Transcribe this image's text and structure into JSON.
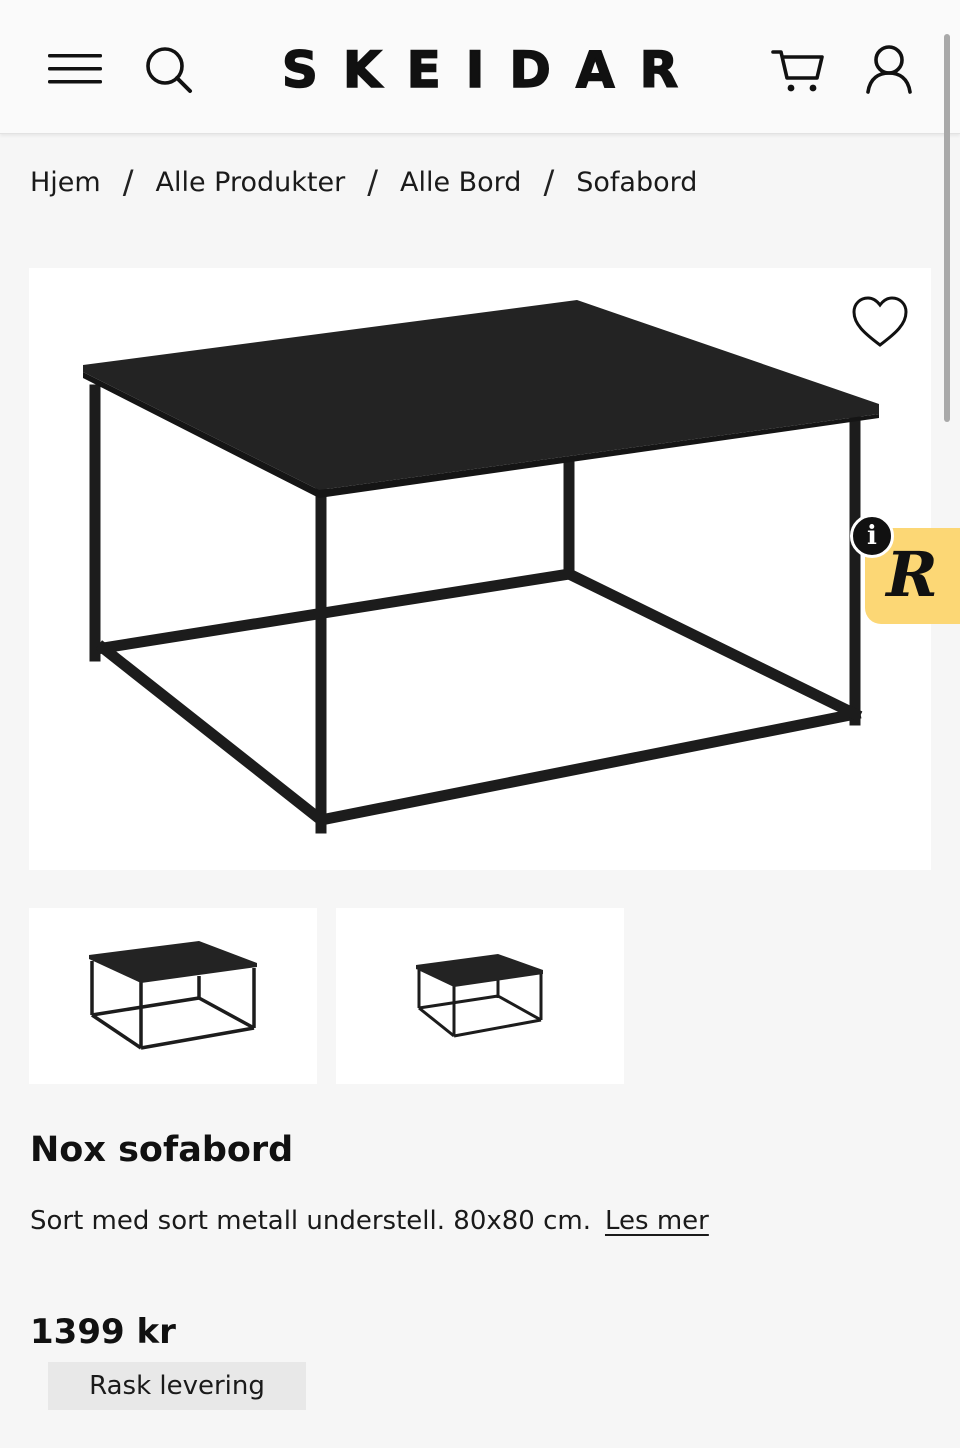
{
  "header": {
    "logo": "SKEIDAR",
    "icons": {
      "menu": "hamburger-icon",
      "search": "search-icon",
      "cart": "cart-icon",
      "user": "user-icon"
    }
  },
  "breadcrumb": {
    "items": [
      "Hjem",
      "Alle Produkter",
      "Alle Bord",
      "Sofabord"
    ],
    "separator": "/"
  },
  "gallery": {
    "main_image": "black-coffee-table-product-photo",
    "favorite_icon": "heart-icon",
    "thumbnails": [
      "thumbnail-1",
      "thumbnail-2"
    ]
  },
  "review_widget": {
    "label": "R",
    "info": "i"
  },
  "product": {
    "title": "Nox sofabord",
    "description": "Sort med sort metall understell. 80x80 cm.",
    "read_more": "Les mer",
    "price": "1399 kr",
    "delivery_badge": "Rask levering"
  },
  "colors": {
    "background": "#f6f6f6",
    "header": "#fafafa",
    "review_badge": "#fcd775",
    "text": "#111111"
  }
}
